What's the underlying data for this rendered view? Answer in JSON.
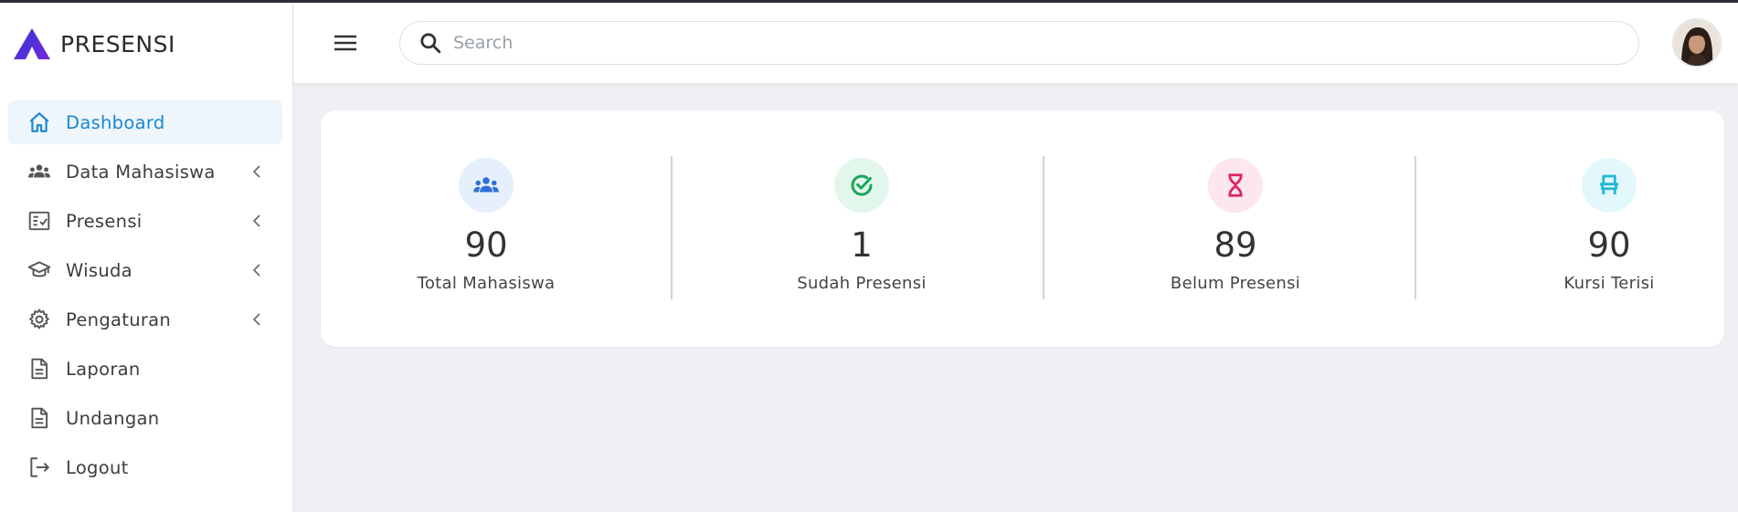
{
  "brand": {
    "name": "PRESENSI",
    "logo_icon": "triangle-logo-icon"
  },
  "sidebar": {
    "items": [
      {
        "label": "Dashboard",
        "icon": "home-icon",
        "active": true,
        "has_submenu": false
      },
      {
        "label": "Data Mahasiswa",
        "icon": "users-icon",
        "active": false,
        "has_submenu": true
      },
      {
        "label": "Presensi",
        "icon": "checklist-icon",
        "active": false,
        "has_submenu": true
      },
      {
        "label": "Wisuda",
        "icon": "graduation-cap-icon",
        "active": false,
        "has_submenu": true
      },
      {
        "label": "Pengaturan",
        "icon": "gear-icon",
        "active": false,
        "has_submenu": true
      },
      {
        "label": "Laporan",
        "icon": "document-icon",
        "active": false,
        "has_submenu": false
      },
      {
        "label": "Undangan",
        "icon": "document-icon",
        "active": false,
        "has_submenu": false
      },
      {
        "label": "Logout",
        "icon": "logout-icon",
        "active": false,
        "has_submenu": false
      }
    ]
  },
  "header": {
    "menu_icon": "hamburger-icon",
    "search": {
      "placeholder": "Search",
      "value": ""
    },
    "avatar_icon": "user-avatar"
  },
  "stats": [
    {
      "value": "90",
      "label": "Total Mahasiswa",
      "icon": "users-icon",
      "color": "#2f6fd6",
      "bg": "#e6f0fd"
    },
    {
      "value": "1",
      "label": "Sudah Presensi",
      "icon": "check-circle-icon",
      "color": "#17a65b",
      "bg": "#e3f6ec"
    },
    {
      "value": "89",
      "label": "Belum Presensi",
      "icon": "hourglass-icon",
      "color": "#e0245e",
      "bg": "#fde6ee"
    },
    {
      "value": "90",
      "label": "Kursi Terisi",
      "icon": "chair-icon",
      "color": "#1fb6d6",
      "bg": "#e3f8fc"
    }
  ],
  "colors": {
    "accent": "#1a87d1",
    "logo_purple": "#5b2bd9"
  }
}
